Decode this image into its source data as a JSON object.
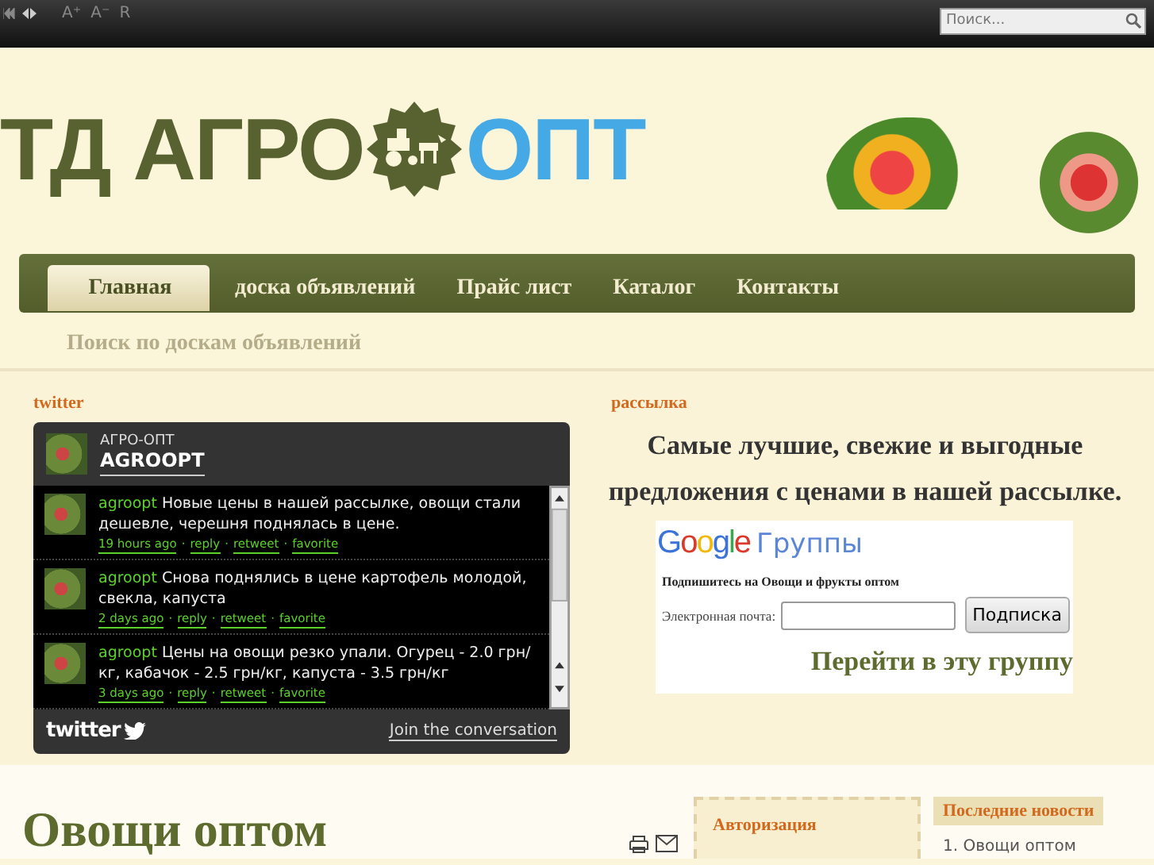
{
  "toolbar": {
    "font_buttons": [
      "A⁺",
      "A⁻",
      "R"
    ]
  },
  "search": {
    "placeholder": "Поиск..."
  },
  "logo": {
    "left": "ТД АГРО",
    "right": "ОПТ"
  },
  "nav": [
    {
      "label": "Главная",
      "selected": true
    },
    {
      "label": "доска объявлений",
      "selected": false
    },
    {
      "label": "Прайс лист",
      "selected": false
    },
    {
      "label": "Каталог",
      "selected": false
    },
    {
      "label": "Контакты",
      "selected": false
    }
  ],
  "ads_search_link": "Поиск по доскам объявлений",
  "twitter": {
    "heading": "twitter",
    "account_name": "АГРО-ОПТ",
    "handle": "AGROOPT",
    "tweets": [
      {
        "user": "agroopt",
        "text": "Новые цены в нашей рассылке, овощи стали дешевле, черешня поднялась в цене.",
        "time": "19 hours ago",
        "actions": [
          "reply",
          "retweet",
          "favorite"
        ]
      },
      {
        "user": "agroopt",
        "text": "Снова поднялись в цене картофель молодой, свекла, капуста",
        "time": "2 days ago",
        "actions": [
          "reply",
          "retweet",
          "favorite"
        ]
      },
      {
        "user": "agroopt",
        "text": "Цены на овощи резко упали. Огурец - 2.0 грн/кг, кабачок - 2.5 грн/кг, капуста - 3.5 грн/кг",
        "time": "3 days ago",
        "actions": [
          "reply",
          "retweet",
          "favorite"
        ]
      }
    ],
    "separator": "·",
    "brand": "twitter",
    "footer_link": "Join the conversation"
  },
  "newsletter": {
    "heading": "рассылка",
    "promo": "Самые лучшие, свежие и выгодные предложения с ценами в нашей рассылке.",
    "google_logo": "Google",
    "groups_title": "Группы",
    "subscribe_label": "Подпишитесь на Овощи и фрукты оптом",
    "email_label": "Электронная почта:",
    "subscribe_button": "Подписка",
    "group_link": "Перейти в эту группу"
  },
  "article": {
    "title": "Овощи оптом"
  },
  "login": {
    "heading": "Авторизация"
  },
  "news": {
    "heading": "Последние новости",
    "items": [
      {
        "marker": "1.",
        "title": "Овощи оптом"
      }
    ]
  }
}
